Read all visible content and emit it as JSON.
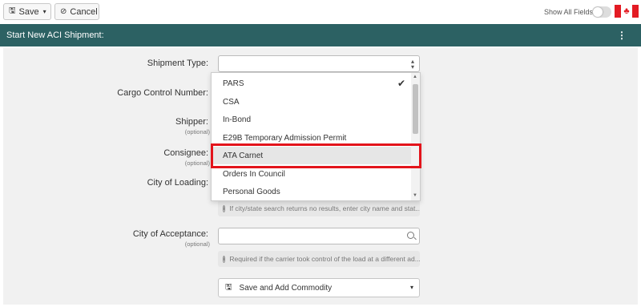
{
  "toolbar": {
    "save_label": "Save",
    "cancel_label": "Cancel",
    "show_all_fields_label": "Show All Fields",
    "show_all_fields_on": false,
    "flag_icon": "canada-flag-icon"
  },
  "header": {
    "title": "Start New ACI Shipment:",
    "menu_icon": "vertical-ellipsis-icon"
  },
  "form": {
    "shipment_type_label": "Shipment Type:",
    "shipment_type_value": "",
    "cargo_control_label": "Cargo Control Number:",
    "shipper_label": "Shipper:",
    "shipper_optional": "(optional)",
    "consignee_label": "Consignee:",
    "consignee_optional": "(optional)",
    "city_loading_label": "City of Loading:",
    "city_loading_hint": "If city/state search returns no results, enter city name and stat...",
    "city_acceptance_label": "City of Acceptance:",
    "city_acceptance_optional": "(optional)",
    "city_acceptance_value": "",
    "city_acceptance_hint": "Required if the carrier took control of the load at a different ad...",
    "save_commodity_label": "Save and Add Commodity"
  },
  "dropdown": {
    "items": [
      {
        "label": "PARS",
        "selected": true
      },
      {
        "label": "CSA",
        "selected": false
      },
      {
        "label": "In-Bond",
        "selected": false
      },
      {
        "label": "E29B Temporary Admission Permit",
        "selected": false
      },
      {
        "label": "ATA Carnet",
        "selected": false,
        "hovered": true
      },
      {
        "label": "Orders In Council",
        "selected": false
      },
      {
        "label": "Personal Goods",
        "selected": false
      }
    ]
  },
  "colors": {
    "header_bg": "#2c6163",
    "highlight": "#e3141b",
    "flag_red": "#e31b23"
  }
}
